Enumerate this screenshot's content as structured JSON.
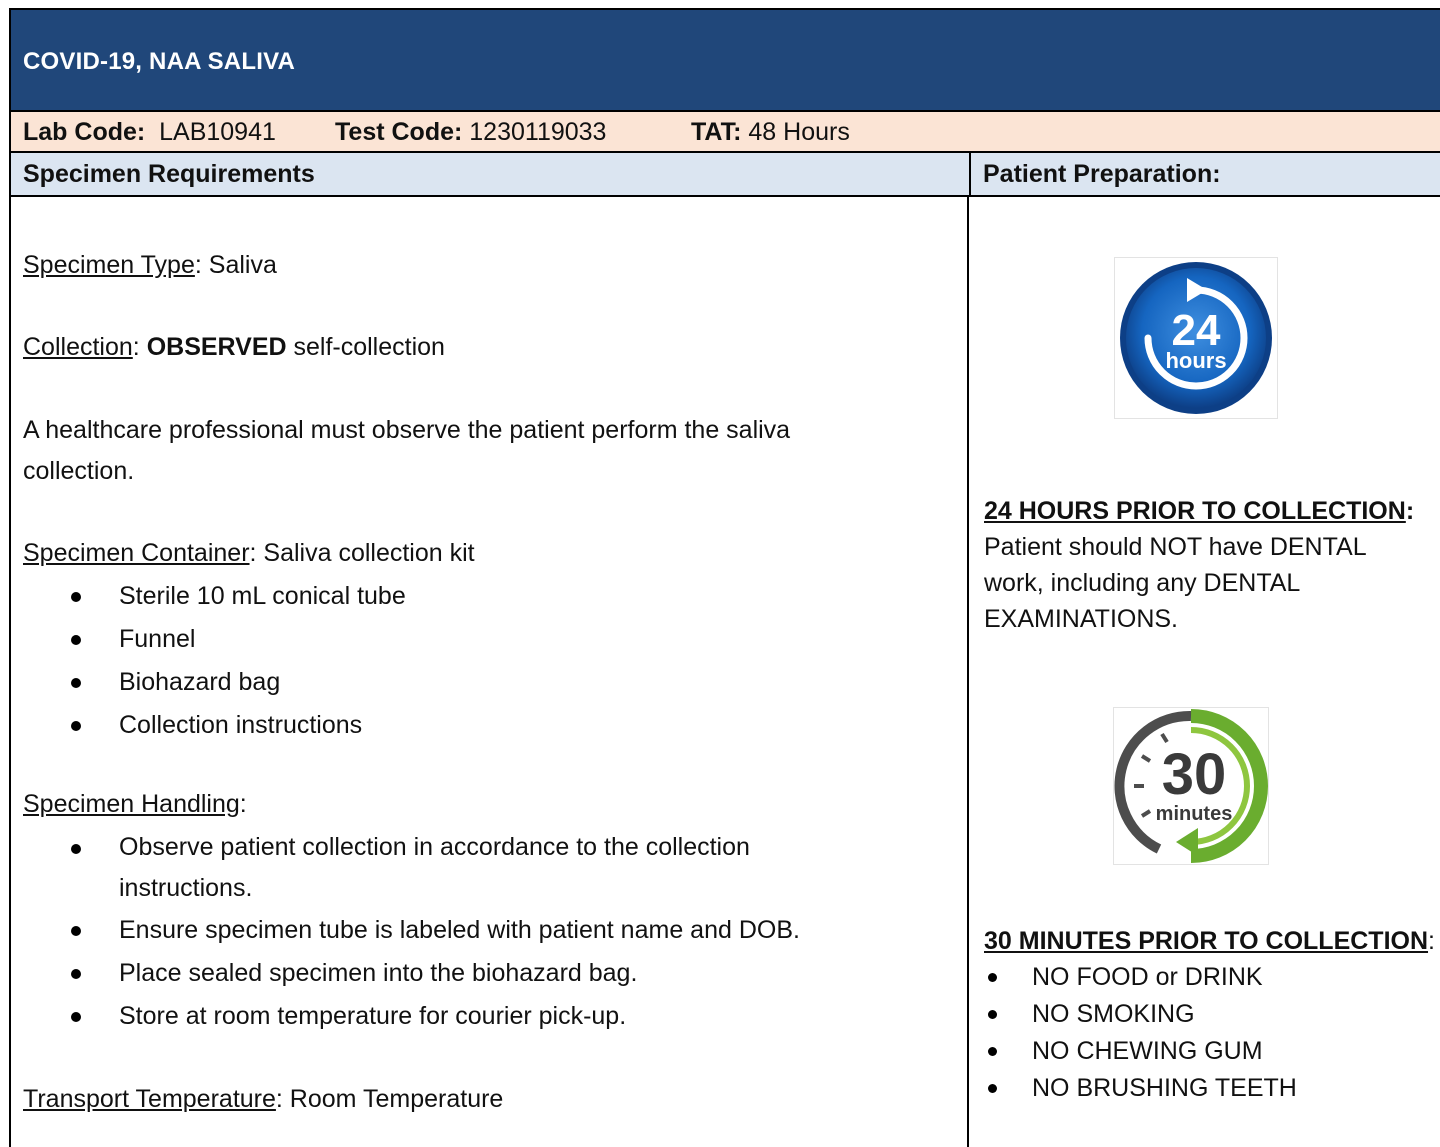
{
  "header": {
    "title": "COVID-19, NAA SALIVA"
  },
  "codes": {
    "lab_code_label": "Lab Code:",
    "lab_code_value": "LAB10941",
    "test_code_label": "Test Code:",
    "test_code_value": "1230119033",
    "tat_label": "TAT:",
    "tat_value": "48 Hours"
  },
  "sections": {
    "left_heading": "Specimen Requirements",
    "right_heading": "Patient Preparation:"
  },
  "specimen": {
    "type_label": "Specimen Type",
    "type_value": ": Saliva",
    "collection_label": "Collection",
    "collection_sep": ": ",
    "collection_bold": "OBSERVED",
    "collection_rest": " self-collection",
    "observe_note_line1": "A healthcare professional must observe the patient perform the saliva",
    "observe_note_line2": "collection.",
    "container_label": "Specimen Container",
    "container_value": ": Saliva collection kit",
    "container_items": [
      "Sterile 10 mL conical tube",
      "Funnel",
      "Biohazard bag",
      "Collection instructions"
    ],
    "handling_label": "Specimen Handling",
    "handling_sep": ":",
    "handling_items": [
      "Observe patient collection in accordance to the collection",
      "instructions.",
      "Ensure specimen tube is labeled with patient name and DOB.",
      "Place sealed specimen into the biohazard bag.",
      "Store at room temperature for courier pick-up."
    ],
    "transport_label": "Transport Temperature",
    "transport_value": ": Room Temperature"
  },
  "preparation": {
    "icon_24": {
      "icon": "24-hours-icon",
      "number": "24",
      "unit": "hours",
      "color": "#1565c0"
    },
    "prior_24_heading": "24 HOURS PRIOR TO COLLECTION",
    "prior_24_colon": ":",
    "prior_24_line1": "Patient should NOT have DENTAL",
    "prior_24_line2": "work, including any DENTAL",
    "prior_24_line3": "EXAMINATIONS.",
    "icon_30": {
      "icon": "30-minutes-icon",
      "number": "30",
      "unit": "minutes",
      "color": "#6aad2f"
    },
    "prior_30_heading": "30 MINUTES PRIOR TO COLLECTION",
    "prior_30_colon": ":",
    "prior_30_items": [
      "NO FOOD or DRINK",
      "NO SMOKING",
      "NO CHEWING GUM",
      "NO BRUSHING TEETH"
    ]
  },
  "colors": {
    "title_bar": "#20477a",
    "code_bar": "#fbe4d5",
    "section_head": "#dbe5f1"
  }
}
